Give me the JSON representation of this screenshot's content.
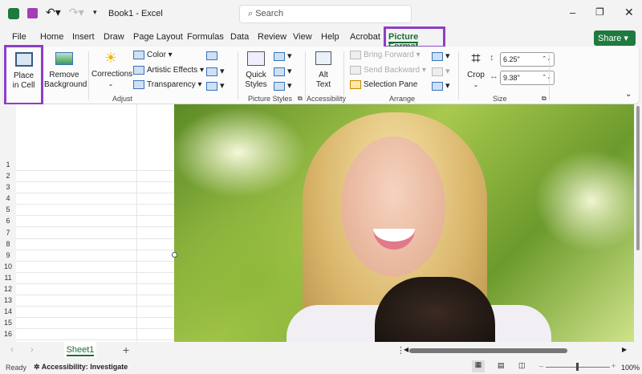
{
  "app": {
    "title": "Book1 - Excel",
    "search_placeholder": "Search"
  },
  "tabs": [
    "File",
    "Home",
    "Insert",
    "Draw",
    "Page Layout",
    "Formulas",
    "Data",
    "Review",
    "View",
    "Help",
    "Acrobat",
    "Picture Format"
  ],
  "share": "Share",
  "ribbon": {
    "place_in_cell": "Place\nin Cell",
    "remove_background": "Remove\nBackground",
    "corrections": "Corrections",
    "color": "Color",
    "artistic_effects": "Artistic Effects",
    "transparency": "Transparency",
    "quick_styles": "Quick\nStyles",
    "alt_text": "Alt\nText",
    "bring_forward": "Bring Forward",
    "send_backward": "Send Backward",
    "selection_pane": "Selection Pane",
    "crop": "Crop",
    "height": "6.25\"",
    "width": "9.38\"",
    "groups": {
      "adjust": "Adjust",
      "picture_styles": "Picture Styles",
      "accessibility": "Accessibility",
      "arrange": "Arrange",
      "size": "Size"
    }
  },
  "rows": [
    "1",
    "2",
    "3",
    "4",
    "5",
    "6",
    "7",
    "8",
    "9",
    "10",
    "11",
    "12",
    "13",
    "14",
    "15",
    "16"
  ],
  "sheet": "Sheet1",
  "status": {
    "ready": "Ready",
    "accessibility": "Accessibility: Investigate",
    "zoom": "100%"
  }
}
